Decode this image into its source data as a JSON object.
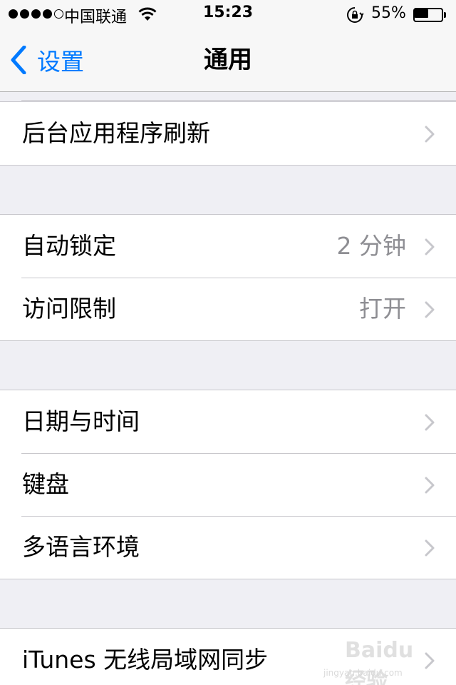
{
  "status_bar": {
    "carrier": "中国联通",
    "time": "15:23",
    "battery_percent_text": "55%",
    "battery_level": 0.55,
    "signal_bars_filled": 4,
    "signal_bars_total": 5
  },
  "nav": {
    "back_label": "设置",
    "title": "通用",
    "accent_color": "#007aff"
  },
  "groups": [
    {
      "rows": [
        {
          "label": "后台应用程序刷新",
          "value": ""
        }
      ]
    },
    {
      "rows": [
        {
          "label": "自动锁定",
          "value": "2 分钟"
        },
        {
          "label": "访问限制",
          "value": "打开"
        }
      ]
    },
    {
      "rows": [
        {
          "label": "日期与时间",
          "value": ""
        },
        {
          "label": "键盘",
          "value": ""
        },
        {
          "label": "多语言环境",
          "value": ""
        }
      ]
    },
    {
      "rows": [
        {
          "label": "iTunes 无线局域网同步",
          "value": ""
        }
      ]
    }
  ],
  "watermark": {
    "brand": "Baidu 经验",
    "url": "jingyan.baidu.com"
  }
}
